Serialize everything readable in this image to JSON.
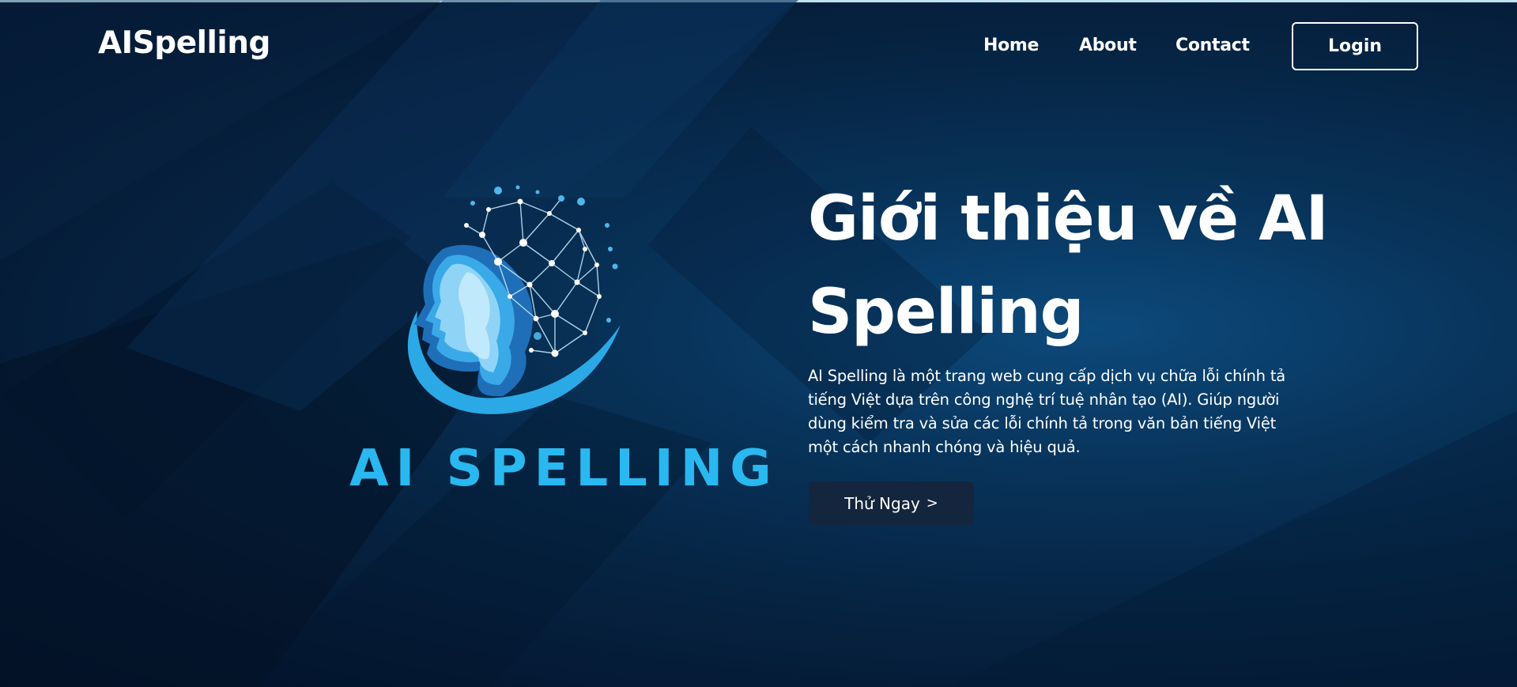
{
  "header": {
    "brand": "AISpelling",
    "nav": [
      {
        "label": "Home"
      },
      {
        "label": "About"
      },
      {
        "label": "Contact"
      }
    ],
    "login_label": "Login"
  },
  "hero": {
    "logo_text": "AI SPELLING",
    "title_line1": "Giới thiệu về AI",
    "title_line2": "Spelling",
    "description": "AI Spelling là một trang web cung cấp dịch vụ chữa lỗi chính tả tiếng Việt dựa trên công nghệ trí tuệ nhân tạo (AI). Giúp người dùng kiểm tra và sửa các lỗi chính tả trong văn bản tiếng Việt một cách nhanh chóng và hiệu quả.",
    "cta_label": "Thử Ngay",
    "cta_icon": "chevron-right-icon"
  },
  "colors": {
    "background": "#062443",
    "accent": "#29b8f0",
    "button_dark": "#14263d"
  }
}
